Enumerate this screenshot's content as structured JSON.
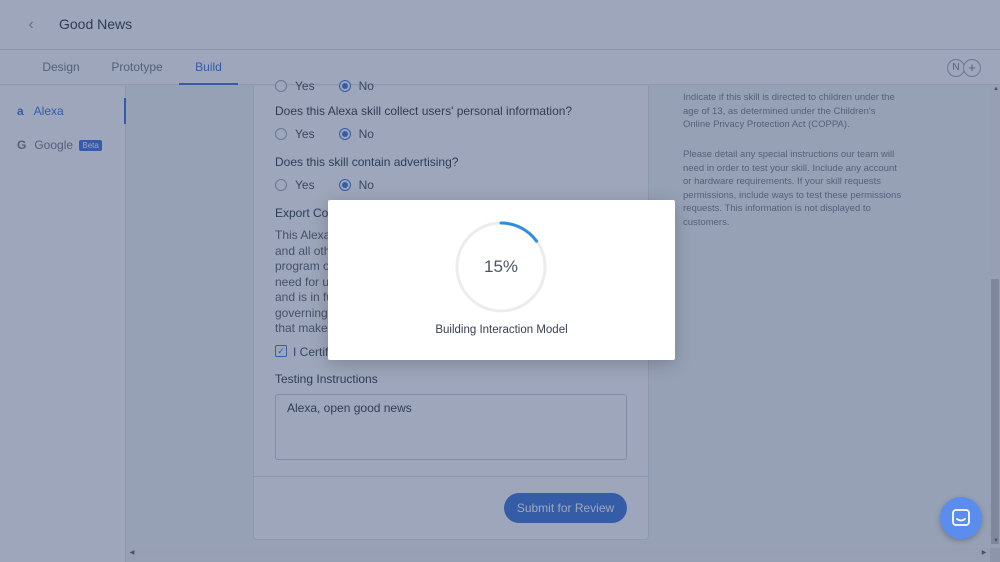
{
  "header": {
    "back_icon": "chevron-left-icon",
    "title": "Good News"
  },
  "tabs": [
    {
      "label": "Design",
      "active": false
    },
    {
      "label": "Prototype",
      "active": false
    },
    {
      "label": "Build",
      "active": true
    }
  ],
  "collaborators": {
    "avatar_initial": "N",
    "add_icon": "plus-icon"
  },
  "sidebar": {
    "items": [
      {
        "label": "Alexa",
        "icon": "amazon-icon",
        "active": true
      },
      {
        "label": "Google",
        "icon": "google-icon",
        "badge": "Beta",
        "active": false
      }
    ]
  },
  "form": {
    "top_partial": {
      "yes": "Yes",
      "no": "No"
    },
    "q_personal_info": "Does this Alexa skill collect users' personal information?",
    "q_advertising": "Does this skill contain advertising?",
    "yes_label": "Yes",
    "no_label": "No",
    "export_title_partial": "Export Cor",
    "export_lines_partial": [
      "This Alexa",
      "and all oth",
      "program o",
      "need for us",
      "and is in fu",
      "governing",
      "that makes"
    ],
    "certify_partial": "I Certif",
    "testing_label": "Testing Instructions",
    "testing_value": "Alexa, open good news",
    "submit_label": "Submit for Review"
  },
  "help": {
    "coppa": "Indicate if this skill is directed to children under the age of 13, as determined under the Children's Online Privacy Protection Act (COPPA).",
    "testing": "Please detail any special instructions our team will need in order to test your skill. Include any account or hardware requirements. If your skill requests permissions, include ways to test these permissions requests. This information is not displayed to customers."
  },
  "modal": {
    "progress_text": "15%",
    "progress_value": 0.15,
    "message": "Building Interaction Model"
  },
  "colors": {
    "accent": "#2f6bd8",
    "overlay": "#3c4e76",
    "chat": "#5b8def"
  },
  "chat": {
    "icon": "chat-icon"
  }
}
